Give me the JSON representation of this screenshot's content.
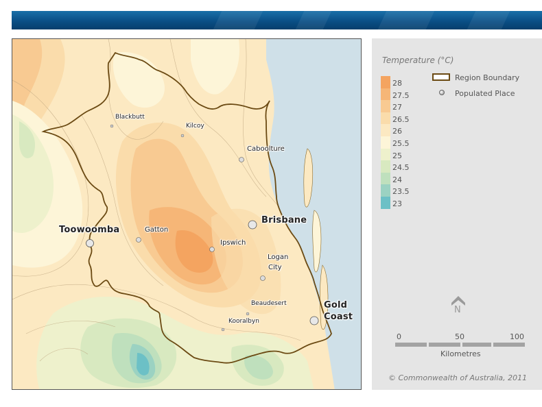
{
  "legend": {
    "title": "Temperature (°C)",
    "scale": [
      {
        "label": "28",
        "color": "#f4a460"
      },
      {
        "label": "27.5",
        "color": "#f6b677"
      },
      {
        "label": "27",
        "color": "#f8ca92"
      },
      {
        "label": "26.5",
        "color": "#fadcab"
      },
      {
        "label": "26",
        "color": "#fce9c2"
      },
      {
        "label": "25.5",
        "color": "#fdf5d8"
      },
      {
        "label": "25",
        "color": "#eef1cc"
      },
      {
        "label": "24.5",
        "color": "#d8e9c0"
      },
      {
        "label": "24",
        "color": "#bfe0bd"
      },
      {
        "label": "23.5",
        "color": "#9bd2c2"
      },
      {
        "label": "23",
        "color": "#6cc0c6"
      }
    ],
    "region_boundary_label": "Region Boundary",
    "populated_place_label": "Populated Place",
    "boundary_color": "#6b4a13"
  },
  "north_label": "N",
  "scalebar": {
    "ticks": [
      "0",
      "50",
      "100"
    ],
    "units": "Kilometres"
  },
  "copyright": "© Commonwealth of Australia, 2011",
  "places": {
    "toowoomba": "Toowoomba",
    "brisbane": "Brisbane",
    "gold_coast_line1": "Gold",
    "gold_coast_line2": "Coast",
    "blackbutt": "Blackbutt",
    "kilcoy": "Kilcoy",
    "caboolture": "Caboolture",
    "gatton": "Gatton",
    "ipswich": "Ipswich",
    "logan_line1": "Logan",
    "logan_line2": "City",
    "beaudesert": "Beaudesert",
    "kooralbyn": "Kooralbyn"
  },
  "colors": {
    "ocean": "#cfe0e8",
    "banner": "#0a4f86",
    "panel": "#e5e5e5"
  }
}
